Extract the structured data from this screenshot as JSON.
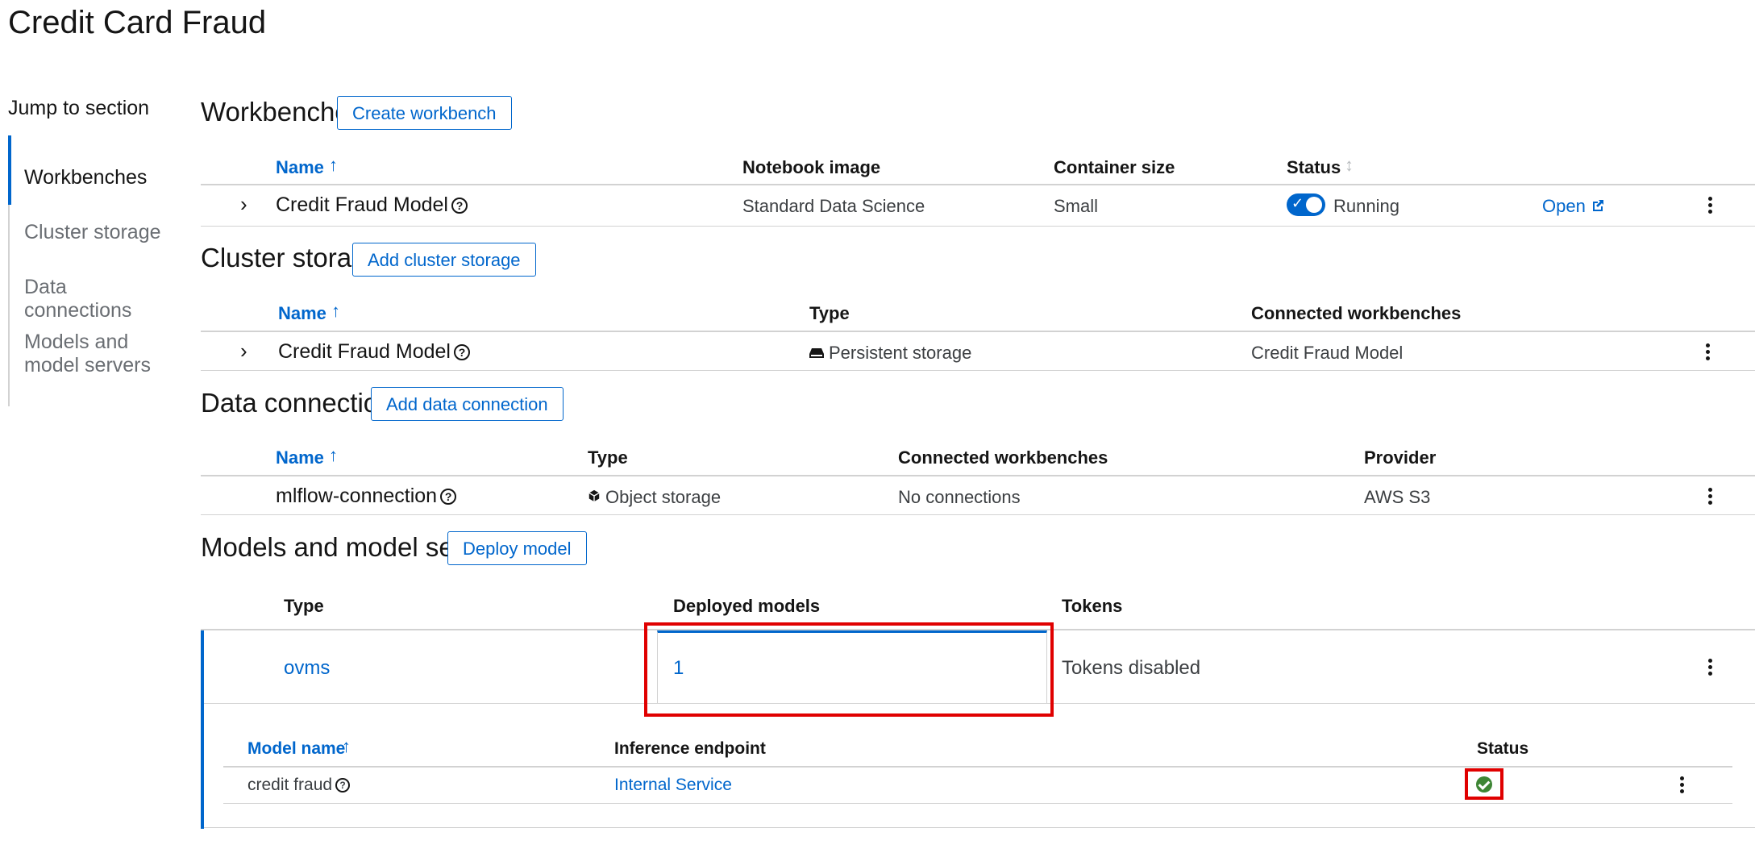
{
  "page": {
    "title": "Credit Card Fraud"
  },
  "jump": {
    "label": "Jump to section",
    "items": [
      "Workbenches",
      "Cluster storage",
      "Data connections",
      "Models and model servers"
    ]
  },
  "workbenches": {
    "title": "Workbenches",
    "button": "Create workbench",
    "headers": {
      "name": "Name",
      "image": "Notebook image",
      "size": "Container size",
      "status": "Status"
    },
    "row": {
      "name": "Credit Fraud Model",
      "image": "Standard Data Science",
      "size": "Small",
      "status": "Running",
      "action": "Open"
    }
  },
  "cluster_storage": {
    "title": "Cluster storage",
    "button": "Add cluster storage",
    "headers": {
      "name": "Name",
      "type": "Type",
      "connected": "Connected workbenches"
    },
    "row": {
      "name": "Credit Fraud Model",
      "type": "Persistent storage",
      "connected": "Credit Fraud Model"
    }
  },
  "data_connections": {
    "title": "Data connections",
    "button": "Add data connection",
    "headers": {
      "name": "Name",
      "type": "Type",
      "connected": "Connected workbenches",
      "provider": "Provider"
    },
    "row": {
      "name": "mlflow-connection",
      "type": "Object storage",
      "connected": "No connections",
      "provider": "AWS S3"
    }
  },
  "models": {
    "title": "Models and model servers",
    "button": "Deploy model",
    "headers": {
      "type": "Type",
      "deployed": "Deployed models",
      "tokens": "Tokens"
    },
    "row": {
      "type": "ovms",
      "deployed": "1",
      "tokens": "Tokens disabled"
    },
    "sub_headers": {
      "name": "Model name",
      "endpoint": "Inference endpoint",
      "status": "Status"
    },
    "sub_row": {
      "name": "credit fraud",
      "endpoint": "Internal Service",
      "status_icon": "check-circle-icon"
    }
  },
  "colors": {
    "accent": "#0066cc",
    "success": "#3e8635",
    "highlight": "#e00000"
  }
}
